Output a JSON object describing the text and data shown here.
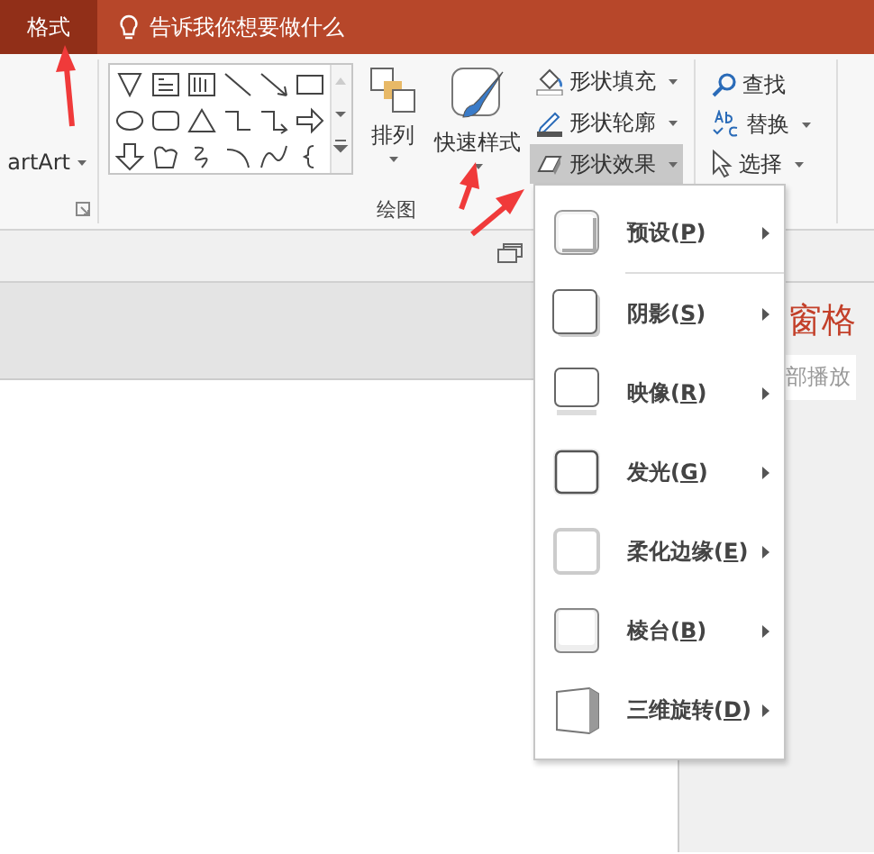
{
  "title_bar": {
    "tabs": [
      {
        "label": "格式",
        "selected": true
      }
    ],
    "tell_me": "告诉我你想要做什么"
  },
  "ribbon": {
    "smartart": {
      "label": "artArt"
    },
    "arrange": {
      "label": "排列"
    },
    "quick_styles": {
      "label": "快速样式"
    },
    "group_label": "绘图",
    "shape_commands": [
      {
        "label": "形状填充",
        "kind": "fill",
        "expanded": false
      },
      {
        "label": "形状轮廓",
        "kind": "outline",
        "expanded": false
      },
      {
        "label": "形状效果",
        "kind": "effects",
        "expanded": true
      }
    ],
    "editing": [
      {
        "label": "查找",
        "kind": "find",
        "dropdown": false
      },
      {
        "label": "替换",
        "kind": "replace",
        "dropdown": true
      },
      {
        "label": "选择",
        "kind": "select",
        "dropdown": true
      }
    ]
  },
  "pane": {
    "title": "窗格",
    "button": "部播放"
  },
  "effects_menu": {
    "items": [
      {
        "label": "预设(**P**)",
        "kind": "preset"
      },
      {
        "label": "阴影(**S**)",
        "kind": "shadow"
      },
      {
        "label": "映像(**R**)",
        "kind": "reflection"
      },
      {
        "label": "发光(**G**)",
        "kind": "glow"
      },
      {
        "label": "柔化边缘(**E**)",
        "kind": "soft"
      },
      {
        "label": "棱台(**B**)",
        "kind": "bevel"
      },
      {
        "label": "三维旋转(**D**)",
        "kind": "rotation"
      }
    ]
  }
}
